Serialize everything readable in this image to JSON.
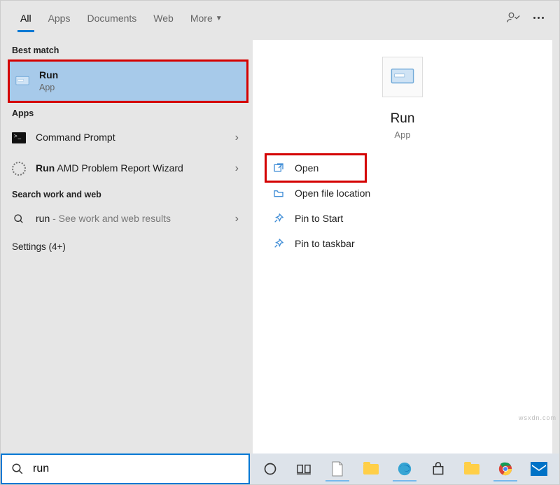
{
  "tabs": {
    "all": "All",
    "apps": "Apps",
    "documents": "Documents",
    "web": "Web",
    "more": "More"
  },
  "left": {
    "best_match_label": "Best match",
    "best": {
      "title": "Run",
      "subtitle": "App"
    },
    "apps_label": "Apps",
    "app_results": [
      {
        "title": "Command Prompt",
        "bold_prefix": ""
      },
      {
        "title_bold": "Run",
        "title_rest": " AMD Problem Report Wizard"
      }
    ],
    "search_web_label": "Search work and web",
    "web_result": {
      "bold": "run",
      "rest": " - See work and web results"
    },
    "settings_label": "Settings (4+)"
  },
  "preview": {
    "title": "Run",
    "subtitle": "App",
    "actions": {
      "open": "Open",
      "open_loc": "Open file location",
      "pin_start": "Pin to Start",
      "pin_taskbar": "Pin to taskbar"
    }
  },
  "search": {
    "value": "run"
  },
  "watermark": "wsxdn.com"
}
